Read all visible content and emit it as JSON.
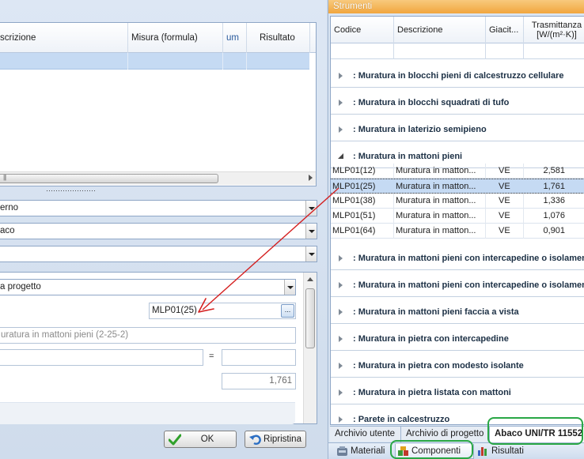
{
  "left": {
    "grid": {
      "columns": [
        "scrizione",
        "Misura (formula)",
        "um",
        "Risultato"
      ]
    },
    "combos": [
      "erno",
      "aco",
      ""
    ],
    "props": {
      "source_value": "a progetto",
      "code_value": "MLP01(25)",
      "code_button": "...",
      "description_value": "uratura in mattoni pieni (2-25-2)",
      "formula_value": "",
      "equals": "=",
      "formula_result": "",
      "result_value": "1,761"
    },
    "buttons": {
      "ok": "OK",
      "restore": "Ripristina"
    }
  },
  "right": {
    "title": "Strumenti",
    "columns": [
      "Codice",
      "Descrizione",
      "Giacit...",
      "Trasmittanza\n[W/(m²·K)]"
    ],
    "groups_top": [
      ": Muratura in blocchi pieni di calcestruzzo cellulare",
      ": Muratura in blocchi squadrati di tufo",
      ": Muratura in laterizio semipieno"
    ],
    "open_group": ": Muratura in mattoni pieni",
    "rows": [
      {
        "code": "MLP01(12)",
        "desc": "Muratura in matton...",
        "pos": "VE",
        "value": "2,581"
      },
      {
        "code": "MLP01(25)",
        "desc": "Muratura in matton...",
        "pos": "VE",
        "value": "1,761"
      },
      {
        "code": "MLP01(38)",
        "desc": "Muratura in matton...",
        "pos": "VE",
        "value": "1,336"
      },
      {
        "code": "MLP01(51)",
        "desc": "Muratura in matton...",
        "pos": "VE",
        "value": "1,076"
      },
      {
        "code": "MLP01(64)",
        "desc": "Muratura in matton...",
        "pos": "VE",
        "value": "0,901"
      }
    ],
    "groups_bottom": [
      ": Muratura in mattoni pieni con intercapedine o isolamento",
      ": Muratura in mattoni pieni con intercapedine o isolamento",
      ": Muratura in mattoni pieni faccia a vista",
      ": Muratura in pietra con intercapedine",
      ": Muratura in pietra con modesto isolante",
      ": Muratura in pietra listata con mattoni",
      ": Parete in calcestruzzo"
    ],
    "tabs": [
      "Archivio utente",
      "Archivio di progetto",
      "Abaco UNI/TR 11552"
    ],
    "bottom_tabs": [
      "Materiali",
      "Componenti",
      "Risultati"
    ]
  },
  "colors": {
    "title_bar": "#f1a63e",
    "selection": "#c5daf3",
    "highlight": "#29a745",
    "arrow": "#d42020"
  }
}
